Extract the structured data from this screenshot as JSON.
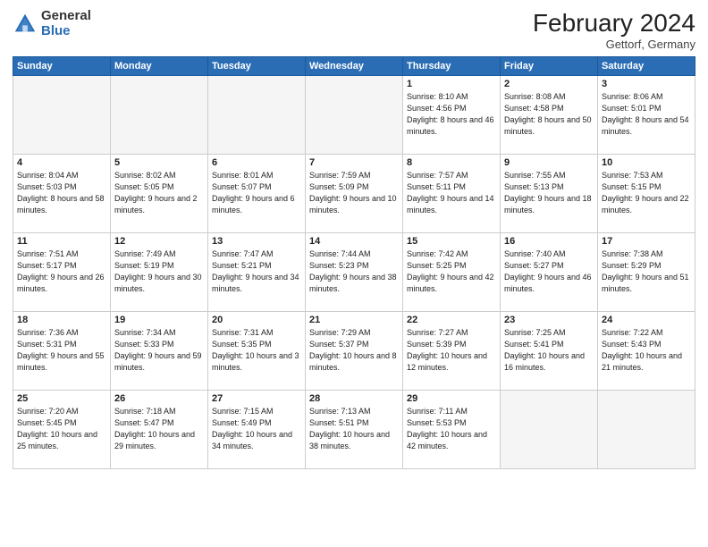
{
  "logo": {
    "general": "General",
    "blue": "Blue"
  },
  "header": {
    "month": "February 2024",
    "location": "Gettorf, Germany"
  },
  "days_of_week": [
    "Sunday",
    "Monday",
    "Tuesday",
    "Wednesday",
    "Thursday",
    "Friday",
    "Saturday"
  ],
  "weeks": [
    [
      {
        "day": "",
        "empty": true
      },
      {
        "day": "",
        "empty": true
      },
      {
        "day": "",
        "empty": true
      },
      {
        "day": "",
        "empty": true
      },
      {
        "day": "1",
        "sunrise": "8:10 AM",
        "sunset": "4:56 PM",
        "daylight": "8 hours and 46 minutes."
      },
      {
        "day": "2",
        "sunrise": "8:08 AM",
        "sunset": "4:58 PM",
        "daylight": "8 hours and 50 minutes."
      },
      {
        "day": "3",
        "sunrise": "8:06 AM",
        "sunset": "5:01 PM",
        "daylight": "8 hours and 54 minutes."
      }
    ],
    [
      {
        "day": "4",
        "sunrise": "8:04 AM",
        "sunset": "5:03 PM",
        "daylight": "8 hours and 58 minutes."
      },
      {
        "day": "5",
        "sunrise": "8:02 AM",
        "sunset": "5:05 PM",
        "daylight": "9 hours and 2 minutes."
      },
      {
        "day": "6",
        "sunrise": "8:01 AM",
        "sunset": "5:07 PM",
        "daylight": "9 hours and 6 minutes."
      },
      {
        "day": "7",
        "sunrise": "7:59 AM",
        "sunset": "5:09 PM",
        "daylight": "9 hours and 10 minutes."
      },
      {
        "day": "8",
        "sunrise": "7:57 AM",
        "sunset": "5:11 PM",
        "daylight": "9 hours and 14 minutes."
      },
      {
        "day": "9",
        "sunrise": "7:55 AM",
        "sunset": "5:13 PM",
        "daylight": "9 hours and 18 minutes."
      },
      {
        "day": "10",
        "sunrise": "7:53 AM",
        "sunset": "5:15 PM",
        "daylight": "9 hours and 22 minutes."
      }
    ],
    [
      {
        "day": "11",
        "sunrise": "7:51 AM",
        "sunset": "5:17 PM",
        "daylight": "9 hours and 26 minutes."
      },
      {
        "day": "12",
        "sunrise": "7:49 AM",
        "sunset": "5:19 PM",
        "daylight": "9 hours and 30 minutes."
      },
      {
        "day": "13",
        "sunrise": "7:47 AM",
        "sunset": "5:21 PM",
        "daylight": "9 hours and 34 minutes."
      },
      {
        "day": "14",
        "sunrise": "7:44 AM",
        "sunset": "5:23 PM",
        "daylight": "9 hours and 38 minutes."
      },
      {
        "day": "15",
        "sunrise": "7:42 AM",
        "sunset": "5:25 PM",
        "daylight": "9 hours and 42 minutes."
      },
      {
        "day": "16",
        "sunrise": "7:40 AM",
        "sunset": "5:27 PM",
        "daylight": "9 hours and 46 minutes."
      },
      {
        "day": "17",
        "sunrise": "7:38 AM",
        "sunset": "5:29 PM",
        "daylight": "9 hours and 51 minutes."
      }
    ],
    [
      {
        "day": "18",
        "sunrise": "7:36 AM",
        "sunset": "5:31 PM",
        "daylight": "9 hours and 55 minutes."
      },
      {
        "day": "19",
        "sunrise": "7:34 AM",
        "sunset": "5:33 PM",
        "daylight": "9 hours and 59 minutes."
      },
      {
        "day": "20",
        "sunrise": "7:31 AM",
        "sunset": "5:35 PM",
        "daylight": "10 hours and 3 minutes."
      },
      {
        "day": "21",
        "sunrise": "7:29 AM",
        "sunset": "5:37 PM",
        "daylight": "10 hours and 8 minutes."
      },
      {
        "day": "22",
        "sunrise": "7:27 AM",
        "sunset": "5:39 PM",
        "daylight": "10 hours and 12 minutes."
      },
      {
        "day": "23",
        "sunrise": "7:25 AM",
        "sunset": "5:41 PM",
        "daylight": "10 hours and 16 minutes."
      },
      {
        "day": "24",
        "sunrise": "7:22 AM",
        "sunset": "5:43 PM",
        "daylight": "10 hours and 21 minutes."
      }
    ],
    [
      {
        "day": "25",
        "sunrise": "7:20 AM",
        "sunset": "5:45 PM",
        "daylight": "10 hours and 25 minutes."
      },
      {
        "day": "26",
        "sunrise": "7:18 AM",
        "sunset": "5:47 PM",
        "daylight": "10 hours and 29 minutes."
      },
      {
        "day": "27",
        "sunrise": "7:15 AM",
        "sunset": "5:49 PM",
        "daylight": "10 hours and 34 minutes."
      },
      {
        "day": "28",
        "sunrise": "7:13 AM",
        "sunset": "5:51 PM",
        "daylight": "10 hours and 38 minutes."
      },
      {
        "day": "29",
        "sunrise": "7:11 AM",
        "sunset": "5:53 PM",
        "daylight": "10 hours and 42 minutes."
      },
      {
        "day": "",
        "empty": true
      },
      {
        "day": "",
        "empty": true
      }
    ]
  ]
}
